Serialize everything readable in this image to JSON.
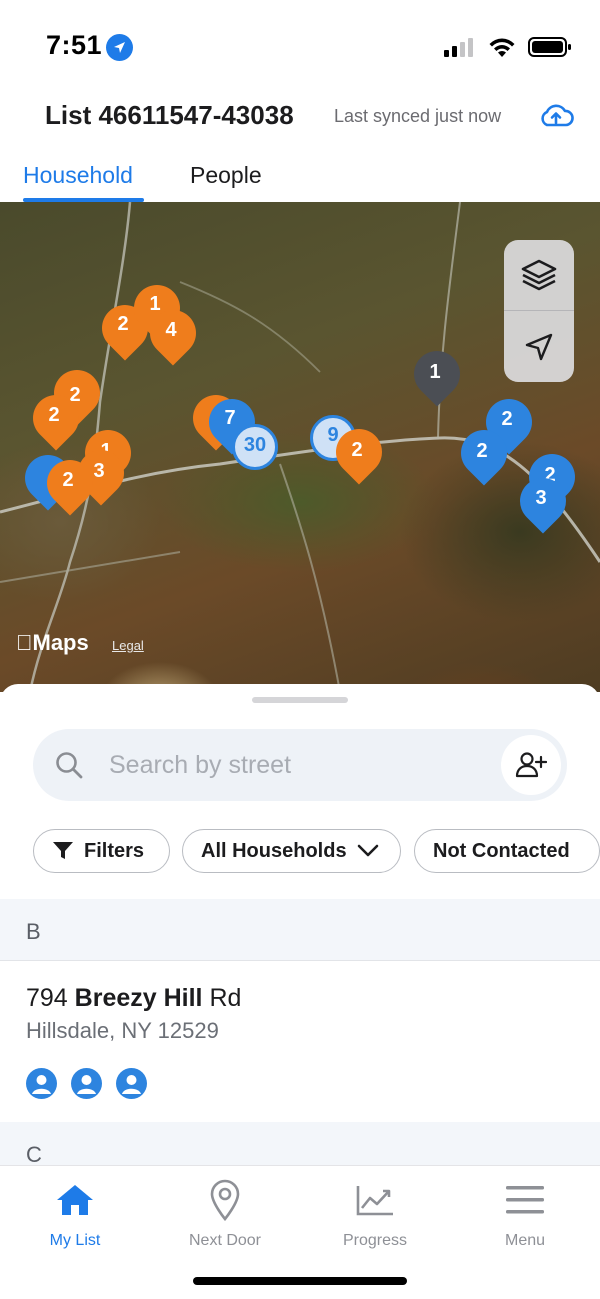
{
  "status_bar": {
    "time": "7:51"
  },
  "header": {
    "list_title": "List 46611547-43038",
    "sync_status": "Last synced just now"
  },
  "tabs": [
    {
      "label": "Household",
      "active": true
    },
    {
      "label": "People",
      "active": false
    }
  ],
  "map": {
    "attribution": "Maps",
    "legal": "Legal",
    "pins": [
      {
        "label": "2",
        "color": "orange"
      },
      {
        "label": "1",
        "color": "orange"
      },
      {
        "label": "4",
        "color": "orange"
      },
      {
        "label": "2",
        "color": "orange"
      },
      {
        "label": "2",
        "color": "orange"
      },
      {
        "label": "1",
        "color": "orange"
      },
      {
        "label": "3",
        "color": "orange"
      },
      {
        "label": "2",
        "color": "orange"
      },
      {
        "label": "7",
        "color": "blue"
      },
      {
        "label": "30",
        "color": "blue-cluster"
      },
      {
        "label": "9",
        "color": "blue-cluster"
      },
      {
        "label": "2",
        "color": "orange"
      },
      {
        "label": "1",
        "color": "gray"
      },
      {
        "label": "2",
        "color": "blue"
      },
      {
        "label": "2",
        "color": "blue"
      },
      {
        "label": "2",
        "color": "blue"
      },
      {
        "label": "3",
        "color": "blue"
      }
    ]
  },
  "search": {
    "placeholder": "Search by street"
  },
  "filters": {
    "filters_label": "Filters",
    "households_label": "All Households",
    "contact_label": "Not Contacted"
  },
  "sections": [
    {
      "letter": "B",
      "rows": [
        {
          "number": "794",
          "street_name": "Breezy Hill",
          "suffix": "Rd",
          "city_line": "Hillsdale, NY 12529",
          "people_count": 3
        }
      ]
    },
    {
      "letter": "C",
      "rows": []
    }
  ],
  "tabbar": [
    {
      "label": "My List",
      "icon": "home-icon",
      "active": true
    },
    {
      "label": "Next Door",
      "icon": "location-pin-icon",
      "active": false
    },
    {
      "label": "Progress",
      "icon": "trend-chart-icon",
      "active": false
    },
    {
      "label": "Menu",
      "icon": "hamburger-menu-icon",
      "active": false
    }
  ],
  "colors": {
    "accent": "#1e7be8",
    "pin_orange": "#ef7d1c",
    "pin_blue": "#2d84df",
    "pin_gray": "#4b4e54"
  }
}
